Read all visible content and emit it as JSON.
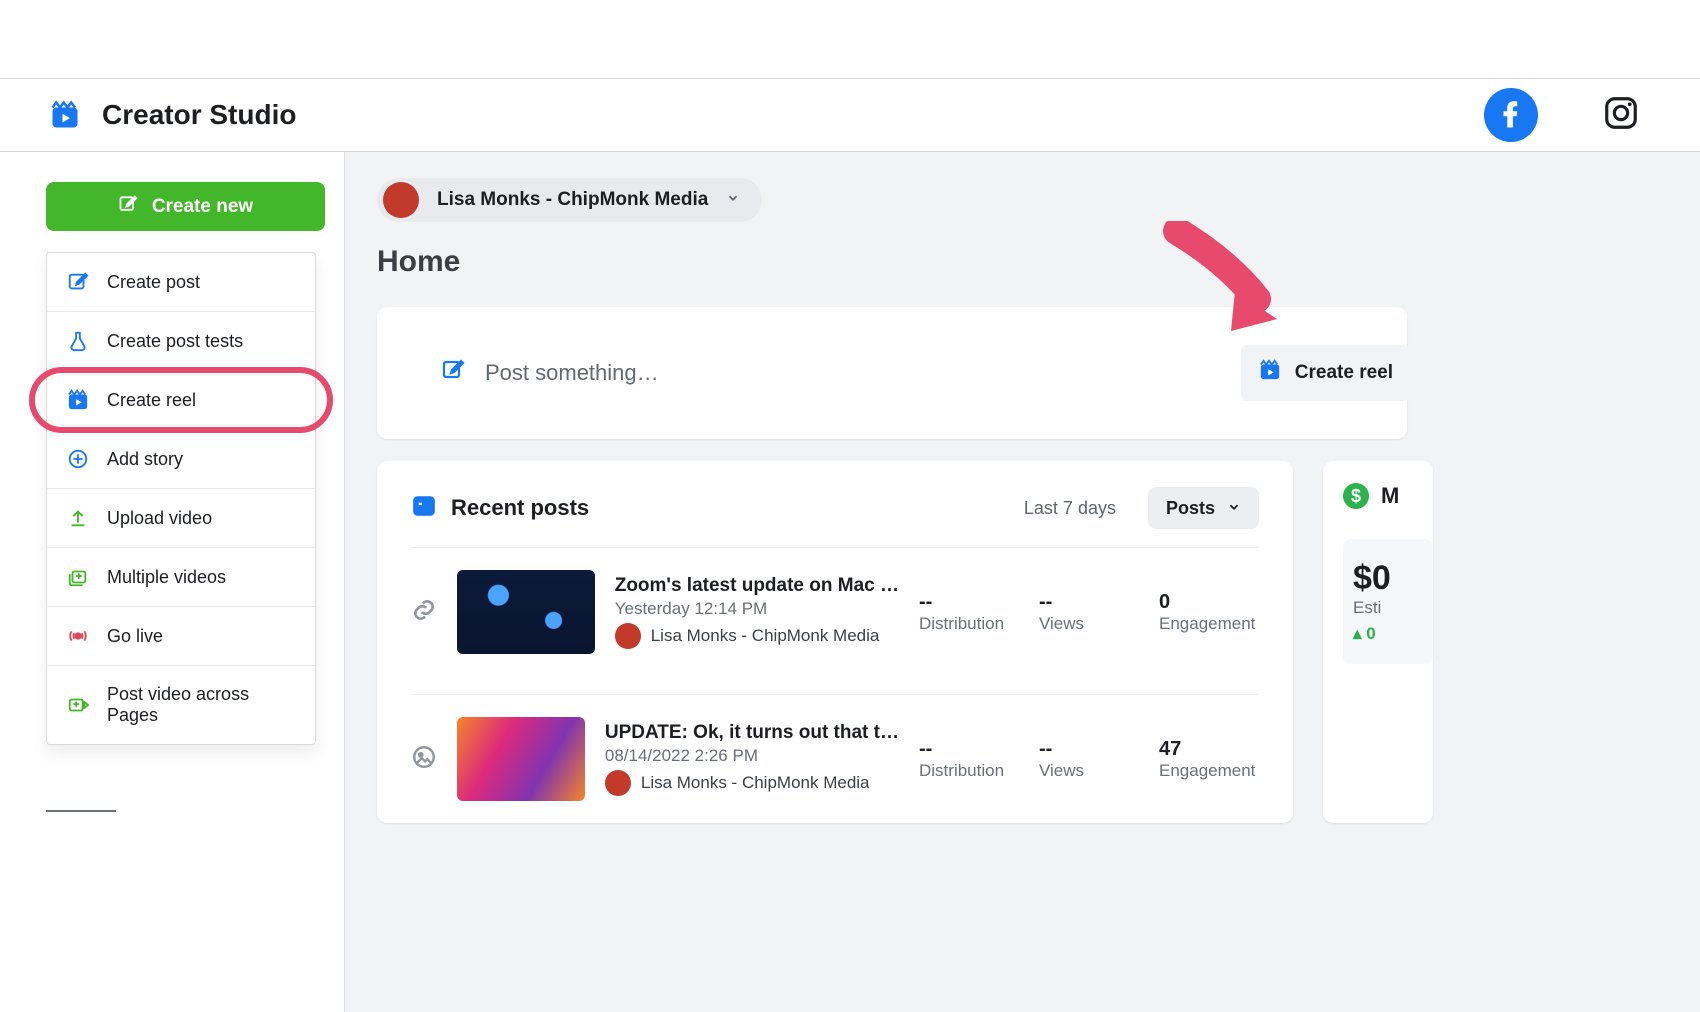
{
  "header": {
    "brand_title": "Creator Studio"
  },
  "sidebar": {
    "create_button": "Create new"
  },
  "create_menu": {
    "items": [
      {
        "icon": "compose-icon",
        "label": "Create post",
        "color": "#1877f2"
      },
      {
        "icon": "flask-icon",
        "label": "Create post tests",
        "color": "#1877f2"
      },
      {
        "icon": "reel-icon",
        "label": "Create reel",
        "color": "#1877f2",
        "highlighted": true
      },
      {
        "icon": "plus-circle-icon",
        "label": "Add story",
        "color": "#1877f2"
      },
      {
        "icon": "upload-icon",
        "label": "Upload video",
        "color": "#42b72a"
      },
      {
        "icon": "multi-video-icon",
        "label": "Multiple videos",
        "color": "#42b72a"
      },
      {
        "icon": "live-icon",
        "label": "Go live",
        "color": "#e0485a"
      },
      {
        "icon": "cross-post-icon",
        "label": "Post video across Pages",
        "color": "#42b72a"
      }
    ]
  },
  "account": {
    "name": "Lisa Monks - ChipMonk Media"
  },
  "page_title": "Home",
  "composer": {
    "placeholder": "Post something…",
    "create_reel": "Create reel"
  },
  "recent": {
    "heading": "Recent posts",
    "range": "Last 7 days",
    "filter": "Posts",
    "posts": [
      {
        "type": "link",
        "title": "Zoom's latest update on Mac …",
        "date": "Yesterday 12:14 PM",
        "author": "Lisa Monks - ChipMonk Media",
        "distribution": "--",
        "views": "--",
        "engagement": "0"
      },
      {
        "type": "image",
        "title": "UPDATE: Ok, it turns out that t…",
        "date": "08/14/2022 2:26 PM",
        "author": "Lisa Monks - ChipMonk Media",
        "distribution": "--",
        "views": "--",
        "engagement": "47"
      }
    ],
    "labels": {
      "distribution": "Distribution",
      "views": "Views",
      "engagement": "Engagement"
    }
  },
  "money": {
    "heading": "M",
    "amount": "$0",
    "subtitle": "Esti",
    "delta": "0"
  }
}
